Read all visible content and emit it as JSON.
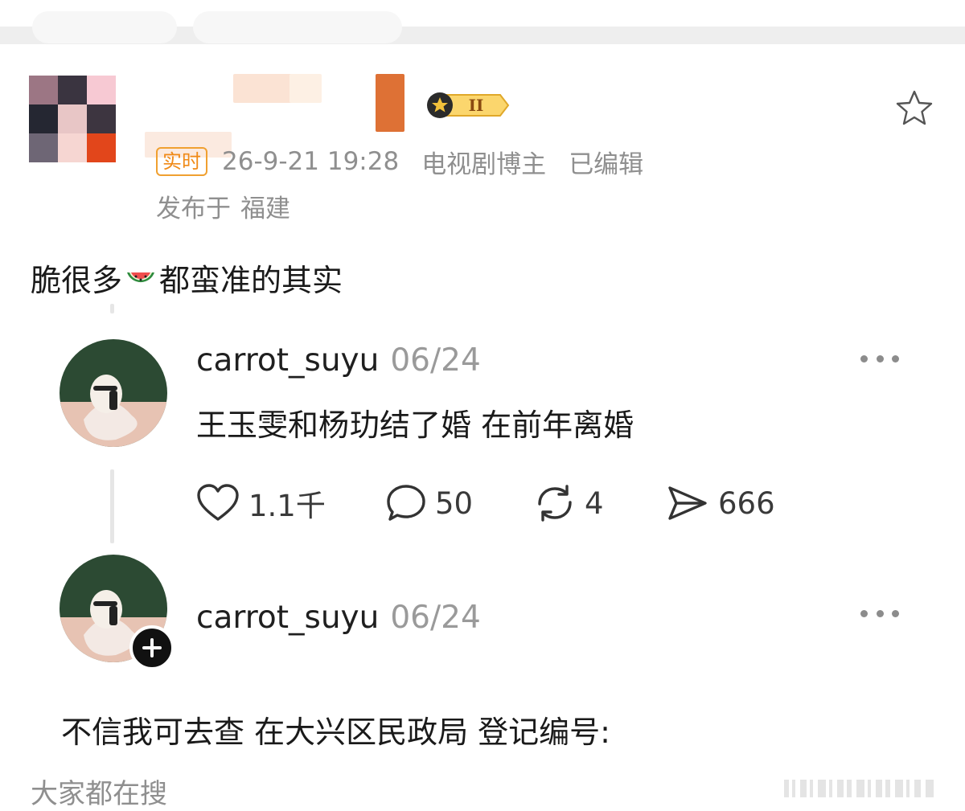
{
  "post": {
    "live_tag": "实时",
    "timestamp": "26-9-21 19:28",
    "category": "电视剧博主",
    "edited_label": "已编辑",
    "location_prefix": "发布于",
    "location": "福建",
    "text_before_emoji": "脆很多",
    "emoji": "watermelon-emoji",
    "text_after_emoji": "都蛮准的其实",
    "vip_level": "II",
    "icons": {
      "favorite": "star-icon",
      "vip": "vip-crown-badge"
    }
  },
  "comments": [
    {
      "username": "carrot_suyu",
      "date": "06/24",
      "text": "王玉雯和杨玏结了婚 在前年离婚",
      "actions": {
        "likes": "1.1千",
        "replies": "50",
        "reposts": "4",
        "shares": "666"
      }
    },
    {
      "username": "carrot_suyu",
      "date": "06/24",
      "text": "不信我可去查 在大兴区民政局 登记编号:"
    }
  ],
  "footer": {
    "label": "大家都在搜"
  },
  "colors": {
    "accent_orange": "#f08a17",
    "meta_gray": "#8f8f8f",
    "text_dark": "#1a1a1a"
  }
}
